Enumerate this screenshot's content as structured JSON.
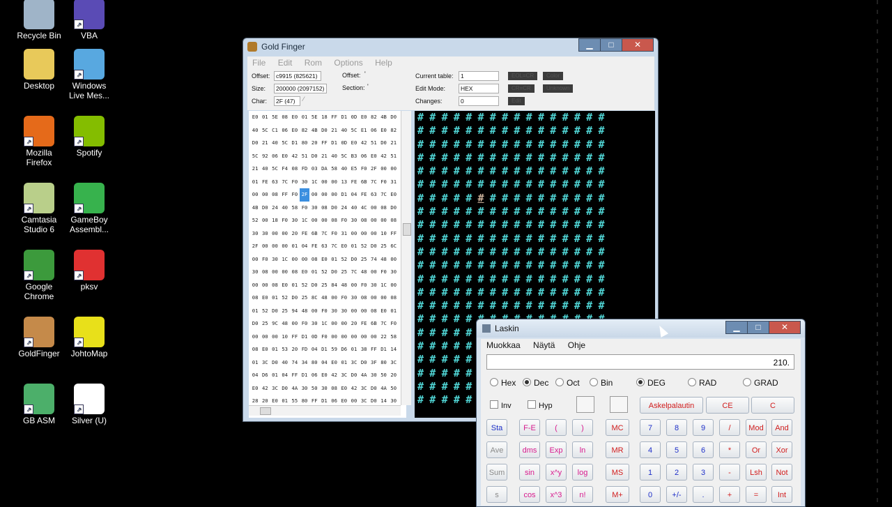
{
  "desktop": {
    "icons": [
      {
        "label": "Recycle Bin",
        "icon": "recycle-bin-icon",
        "color": "#9fb4c8"
      },
      {
        "label": "VBA",
        "icon": "vba-icon",
        "color": "#5a4bb5"
      },
      {
        "label": "Desktop",
        "icon": "folder-icon",
        "color": "#e8c95a"
      },
      {
        "label": "Windows Live Mes...",
        "icon": "messenger-icon",
        "color": "#58a8e0"
      },
      {
        "label": "Mozilla Firefox",
        "icon": "firefox-icon",
        "color": "#e56a1a"
      },
      {
        "label": "Spotify",
        "icon": "spotify-icon",
        "color": "#84bd00"
      },
      {
        "label": "Camtasia Studio 6",
        "icon": "camtasia-icon",
        "color": "#b9cf8a"
      },
      {
        "label": "GameBoy Assembl...",
        "icon": "gameboy-icon",
        "color": "#37b24d"
      },
      {
        "label": "Google Chrome",
        "icon": "chrome-icon",
        "color": "#3c9a3c"
      },
      {
        "label": "pksv",
        "icon": "pokeball-icon",
        "color": "#e03131"
      },
      {
        "label": "GoldFinger",
        "icon": "goldfinger-icon",
        "color": "#c58a4a"
      },
      {
        "label": "JohtoMap",
        "icon": "johtomap-icon",
        "color": "#e8e01a"
      },
      {
        "label": "GB ASM",
        "icon": "gbasm-icon",
        "color": "#4caf6a"
      },
      {
        "label": "Silver (U)",
        "icon": "file-icon",
        "color": "#ffffff"
      }
    ]
  },
  "goldfinger": {
    "title": "Gold Finger",
    "min": "▁",
    "max": "□",
    "close": "✕",
    "menu": [
      "File",
      "Edit",
      "Rom",
      "Options",
      "Help"
    ],
    "info": {
      "offset_label": "Offset:",
      "offset_value": "c9915 (825621)",
      "offset2_label": "Offset:",
      "offset2_value": "'",
      "size_label": "Size:",
      "size_value": "200000 (2097152)",
      "section_label": "Section:",
      "section_value": "'",
      "char_label": "Char:",
      "char_value": "2F (47)",
      "current_table_label": "Current table:",
      "current_table_value": "1",
      "edit_mode_label": "Edit Mode:",
      "edit_mode_value": "HEX",
      "changes_label": "Changes:",
      "changes_value": "0",
      "tag1": "EOL=CR",
      "tag2": "Color",
      "tag3": "CR=CR",
      "tag4": "Unknown",
      "tag5": "Edit"
    },
    "hex_rows": [
      [
        "E0",
        "01",
        "5E",
        "08",
        "E0",
        "01",
        "5E",
        "18",
        "FF",
        "D1",
        "0D",
        "E0",
        "82",
        "4B",
        "D0"
      ],
      [
        "40",
        "5C",
        "C1",
        "06",
        "E0",
        "82",
        "4B",
        "D0",
        "21",
        "40",
        "5C",
        "E1",
        "06",
        "E0",
        "82"
      ],
      [
        "D0",
        "21",
        "40",
        "5C",
        "D1",
        "80",
        "20",
        "FF",
        "D1",
        "0D",
        "E0",
        "42",
        "51",
        "D0",
        "21"
      ],
      [
        "5C",
        "92",
        "06",
        "E0",
        "42",
        "51",
        "D0",
        "21",
        "40",
        "5C",
        "B3",
        "06",
        "E0",
        "42",
        "51"
      ],
      [
        "21",
        "40",
        "5C",
        "F4",
        "08",
        "FD",
        "03",
        "DA",
        "58",
        "40",
        "E5",
        "F0",
        "2F",
        "00",
        "00"
      ],
      [
        "01",
        "FE",
        "63",
        "7C",
        "F0",
        "30",
        "1C",
        "00",
        "00",
        "13",
        "FE",
        "6B",
        "7C",
        "F0",
        "31"
      ],
      [
        "00",
        "00",
        "08",
        "FF",
        "F0",
        "2F",
        "00",
        "00",
        "00",
        "D1",
        "04",
        "FE",
        "63",
        "7C",
        "E0"
      ],
      [
        "4B",
        "D0",
        "24",
        "40",
        "58",
        "F0",
        "30",
        "08",
        "D0",
        "24",
        "40",
        "4C",
        "00",
        "08",
        "D0"
      ],
      [
        "52",
        "00",
        "18",
        "F0",
        "30",
        "1C",
        "00",
        "00",
        "08",
        "F0",
        "30",
        "08",
        "00",
        "00",
        "08"
      ],
      [
        "30",
        "30",
        "00",
        "00",
        "20",
        "FE",
        "6B",
        "7C",
        "F0",
        "31",
        "00",
        "00",
        "00",
        "10",
        "FF"
      ],
      [
        "2F",
        "00",
        "00",
        "00",
        "01",
        "04",
        "FE",
        "63",
        "7C",
        "E0",
        "01",
        "52",
        "D0",
        "25",
        "6C"
      ],
      [
        "00",
        "F0",
        "30",
        "1C",
        "00",
        "00",
        "08",
        "E0",
        "01",
        "52",
        "D0",
        "25",
        "74",
        "48",
        "00"
      ],
      [
        "30",
        "08",
        "00",
        "00",
        "08",
        "E0",
        "01",
        "52",
        "D0",
        "25",
        "7C",
        "48",
        "00",
        "F0",
        "30"
      ],
      [
        "00",
        "00",
        "08",
        "E0",
        "01",
        "52",
        "D0",
        "25",
        "84",
        "48",
        "00",
        "F0",
        "30",
        "1C",
        "00"
      ],
      [
        "08",
        "E0",
        "01",
        "52",
        "D0",
        "25",
        "8C",
        "48",
        "00",
        "F0",
        "30",
        "08",
        "00",
        "00",
        "08"
      ],
      [
        "01",
        "52",
        "D0",
        "25",
        "94",
        "48",
        "00",
        "F0",
        "30",
        "30",
        "00",
        "00",
        "08",
        "E0",
        "01"
      ],
      [
        "D0",
        "25",
        "9C",
        "48",
        "00",
        "F0",
        "30",
        "1C",
        "00",
        "00",
        "20",
        "FE",
        "6B",
        "7C",
        "F0"
      ],
      [
        "00",
        "00",
        "00",
        "10",
        "FF",
        "D1",
        "0D",
        "F0",
        "00",
        "00",
        "00",
        "00",
        "00",
        "22",
        "58"
      ],
      [
        "08",
        "E0",
        "01",
        "53",
        "20",
        "FD",
        "04",
        "D1",
        "59",
        "D6",
        "01",
        "38",
        "FF",
        "D1",
        "14"
      ],
      [
        "01",
        "3C",
        "D0",
        "40",
        "74",
        "34",
        "80",
        "04",
        "E0",
        "01",
        "3C",
        "D0",
        "3F",
        "80",
        "3C"
      ],
      [
        "04",
        "D6",
        "01",
        "04",
        "FF",
        "D1",
        "06",
        "E0",
        "42",
        "3C",
        "D0",
        "4A",
        "30",
        "50",
        "20"
      ],
      [
        "E0",
        "42",
        "3C",
        "D0",
        "4A",
        "30",
        "50",
        "30",
        "08",
        "E0",
        "42",
        "3C",
        "D0",
        "4A",
        "50"
      ],
      [
        "28",
        "20",
        "E0",
        "01",
        "55",
        "80",
        "FF",
        "D1",
        "06",
        "E0",
        "00",
        "3C",
        "D0",
        "14",
        "30"
      ]
    ],
    "tile_char": "#",
    "tile_rows": 22,
    "tile_cols": 16
  },
  "calc": {
    "title": "Laskin",
    "min": "▁",
    "max": "□",
    "close": "✕",
    "menu": [
      "Muokkaa",
      "Näytä",
      "Ohje"
    ],
    "display": "210.",
    "base": {
      "hex": "Hex",
      "dec": "Dec",
      "oct": "Oct",
      "bin": "Bin"
    },
    "angle": {
      "deg": "DEG",
      "rad": "RAD",
      "grad": "GRAD"
    },
    "inv": "Inv",
    "hyp": "Hyp",
    "backspace": "Askelpalautin",
    "ce": "CE",
    "c": "C",
    "rows": [
      [
        "Sta",
        "F-E",
        "(",
        ")",
        "MC",
        "7",
        "8",
        "9",
        "/",
        "Mod",
        "And"
      ],
      [
        "Ave",
        "dms",
        "Exp",
        "ln",
        "MR",
        "4",
        "5",
        "6",
        "*",
        "Or",
        "Xor"
      ],
      [
        "Sum",
        "sin",
        "x^y",
        "log",
        "MS",
        "1",
        "2",
        "3",
        "-",
        "Lsh",
        "Not"
      ],
      [
        "s",
        "cos",
        "x^3",
        "n!",
        "M+",
        "0",
        "+/-",
        ".",
        "+",
        "=",
        "Int"
      ]
    ],
    "colors": {
      "blue": "#1e2fc8",
      "magenta": "#d81b8e",
      "red": "#d11d1d"
    }
  }
}
